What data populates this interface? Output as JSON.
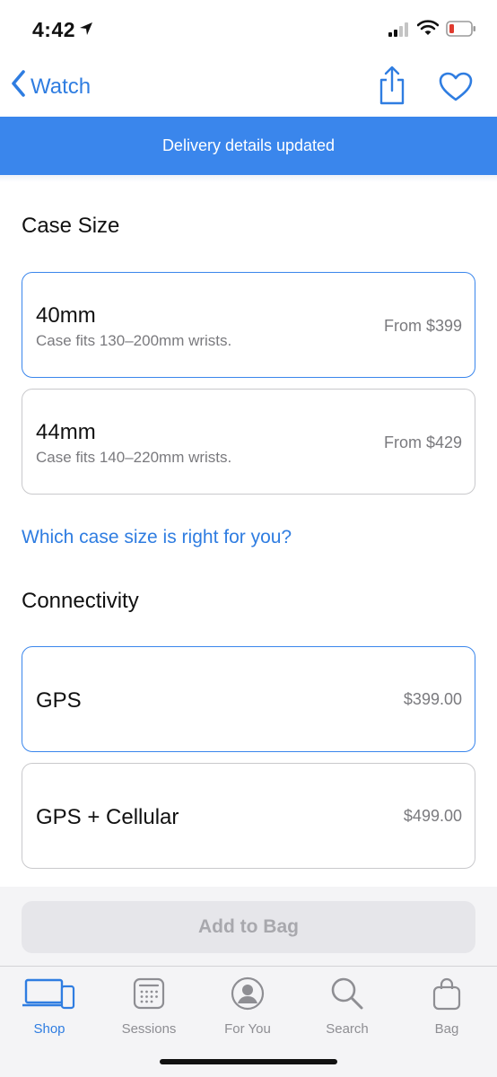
{
  "status": {
    "time": "4:42",
    "icons": [
      "location-arrow-icon",
      "cellular-signal-icon",
      "wifi-icon",
      "battery-low-icon"
    ],
    "battery_color": "#e03b2f"
  },
  "nav": {
    "back_label": "Watch",
    "share_icon": "share-icon",
    "favorite_icon": "heart-icon"
  },
  "banner": {
    "text": "Delivery details updated",
    "color": "#3a86ec"
  },
  "case_size": {
    "title": "Case Size",
    "options": [
      {
        "name": "40mm",
        "desc": "Case fits 130–200mm wrists.",
        "price": "From $399",
        "selected": true
      },
      {
        "name": "44mm",
        "desc": "Case fits 140–220mm wrists.",
        "price": "From $429",
        "selected": false
      }
    ],
    "help_link": "Which case size is right for you?"
  },
  "connectivity": {
    "title": "Connectivity",
    "options": [
      {
        "name": "GPS",
        "price": "$399.00",
        "selected": true
      },
      {
        "name": "GPS + Cellular",
        "price": "$499.00",
        "selected": false
      }
    ]
  },
  "add_to_bag": {
    "label": "Add to Bag",
    "enabled": false
  },
  "tabs": [
    {
      "label": "Shop",
      "icon": "devices-icon",
      "active": true
    },
    {
      "label": "Sessions",
      "icon": "calendar-icon",
      "active": false
    },
    {
      "label": "For You",
      "icon": "person-icon",
      "active": false
    },
    {
      "label": "Search",
      "icon": "search-icon",
      "active": false
    },
    {
      "label": "Bag",
      "icon": "bag-icon",
      "active": false
    }
  ],
  "colors": {
    "accent": "#2f7de1",
    "selected_border": "#3a86ec",
    "inactive": "#8e8e93"
  }
}
